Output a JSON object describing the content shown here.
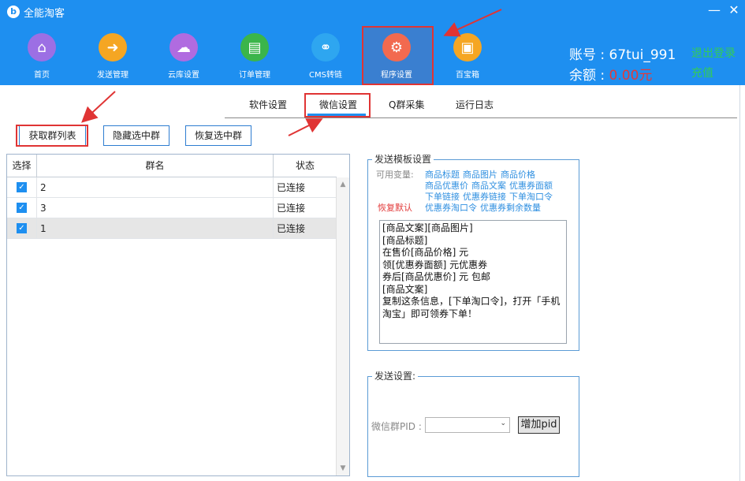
{
  "app": {
    "logo_glyph": "b",
    "title": "全能淘客",
    "minimize": "—",
    "close": "✕"
  },
  "nav": {
    "items": [
      {
        "label": "首页",
        "icon": "home-icon",
        "color": "#9C6FE4",
        "glyph": "⌂"
      },
      {
        "label": "发送管理",
        "icon": "send-file-icon",
        "color": "#F5A623",
        "glyph": "➜"
      },
      {
        "label": "云库设置",
        "icon": "cloud-icon",
        "color": "#B06BE0",
        "glyph": "☁"
      },
      {
        "label": "订单管理",
        "icon": "document-icon",
        "color": "#3BB54A",
        "glyph": "▤"
      },
      {
        "label": "CMS转链",
        "icon": "share-network-icon",
        "color": "#2EA6F0",
        "glyph": "⚭"
      },
      {
        "label": "程序设置",
        "icon": "gear-settings-icon",
        "color": "#F26A4F",
        "glyph": "⚙"
      },
      {
        "label": "百宝箱",
        "icon": "toolbox-icon",
        "color": "#F5A623",
        "glyph": "▣"
      }
    ]
  },
  "account": {
    "label": "账号 : 67tui_991",
    "balance_label": "余额 : ",
    "balance_value": "0.00元",
    "logout": "退出登录",
    "recharge": "充值"
  },
  "subtabs": [
    "软件设置",
    "微信设置",
    "Q群采集",
    "运行日志"
  ],
  "actions": {
    "fetch": "获取群列表",
    "hide": "隐藏选中群",
    "restore": "恢复选中群"
  },
  "table": {
    "headers": [
      "选择",
      "群名",
      "状态"
    ],
    "rows": [
      {
        "checked": "✓",
        "name": "2",
        "status": "已连接"
      },
      {
        "checked": "✓",
        "name": "3",
        "status": "已连接"
      },
      {
        "checked": "✓",
        "name": "1",
        "status": "已连接"
      }
    ],
    "scroll_up": "▲",
    "scroll_down": "▼"
  },
  "template": {
    "title": "发送模板设置",
    "vars_label": "可用变量:",
    "restore_default": "恢复默认",
    "vars": [
      [
        "商品标题",
        "商品图片",
        "商品价格"
      ],
      [
        "商品优惠价",
        "商品文案",
        "优惠券面额"
      ],
      [
        "下单链接",
        "优惠券链接",
        "下单淘口令"
      ],
      [
        "优惠券淘口令",
        "优惠券剩余数量"
      ]
    ],
    "text": "[商品文案][商品图片]\n[商品标题]\n在售价[商品价格] 元\n领[优惠券面额] 元优惠券\n券后[商品优惠价] 元 包邮\n[商品文案]\n复制这条信息，[下单淘口令]，打开「手机淘宝」即可领券下单！"
  },
  "send": {
    "title": "发送设置:",
    "pid_label": "微信群PID :",
    "pid_value": "",
    "dropdown_arrow": "⌄",
    "add_pid": "增加pid"
  },
  "colors": {
    "header_blue": "#1E8FF0",
    "highlight_red": "#E03434",
    "link_blue": "#2F8FE0",
    "green": "#33CC55"
  }
}
